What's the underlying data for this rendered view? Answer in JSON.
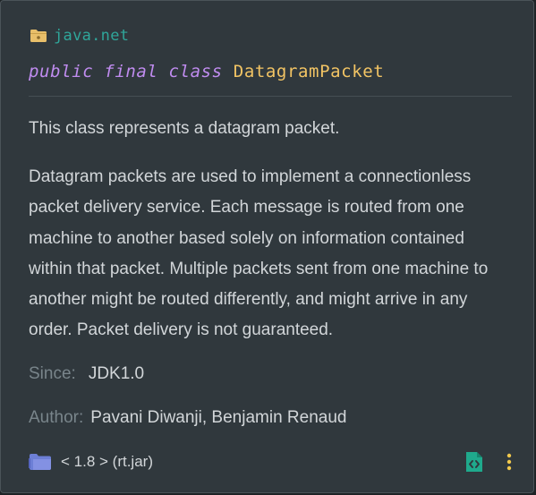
{
  "header": {
    "package_icon": "folder-icon",
    "package_name": "java.net"
  },
  "signature": {
    "modifier_public": "public",
    "modifier_final": "final",
    "keyword_class": "class",
    "class_name": "DatagramPacket"
  },
  "doc": {
    "summary": "This class represents a datagram packet.",
    "description": "Datagram packets are used to implement a connectionless packet delivery service. Each message is routed from one machine to another based solely on information contained within that packet. Multiple packets sent from one machine to another might be routed differently, and might arrive in any order. Packet delivery is not guaranteed."
  },
  "tags": {
    "since_label": "Since:",
    "since_value": "JDK1.0",
    "author_label": "Author:",
    "author_value": "Pavani Diwanji, Benjamin Renaud"
  },
  "footer": {
    "library_icon": "library-folder-icon",
    "library_label": "< 1.8 > (rt.jar)",
    "source_icon": "open-source-file-icon",
    "more_icon": "more-vertical-icon"
  },
  "colors": {
    "background": "#30383d",
    "package": "#2fa69a",
    "keyword": "#c08cf0",
    "class_name": "#f2c464",
    "tag_label": "#79858b",
    "text": "#d2d6d9"
  }
}
